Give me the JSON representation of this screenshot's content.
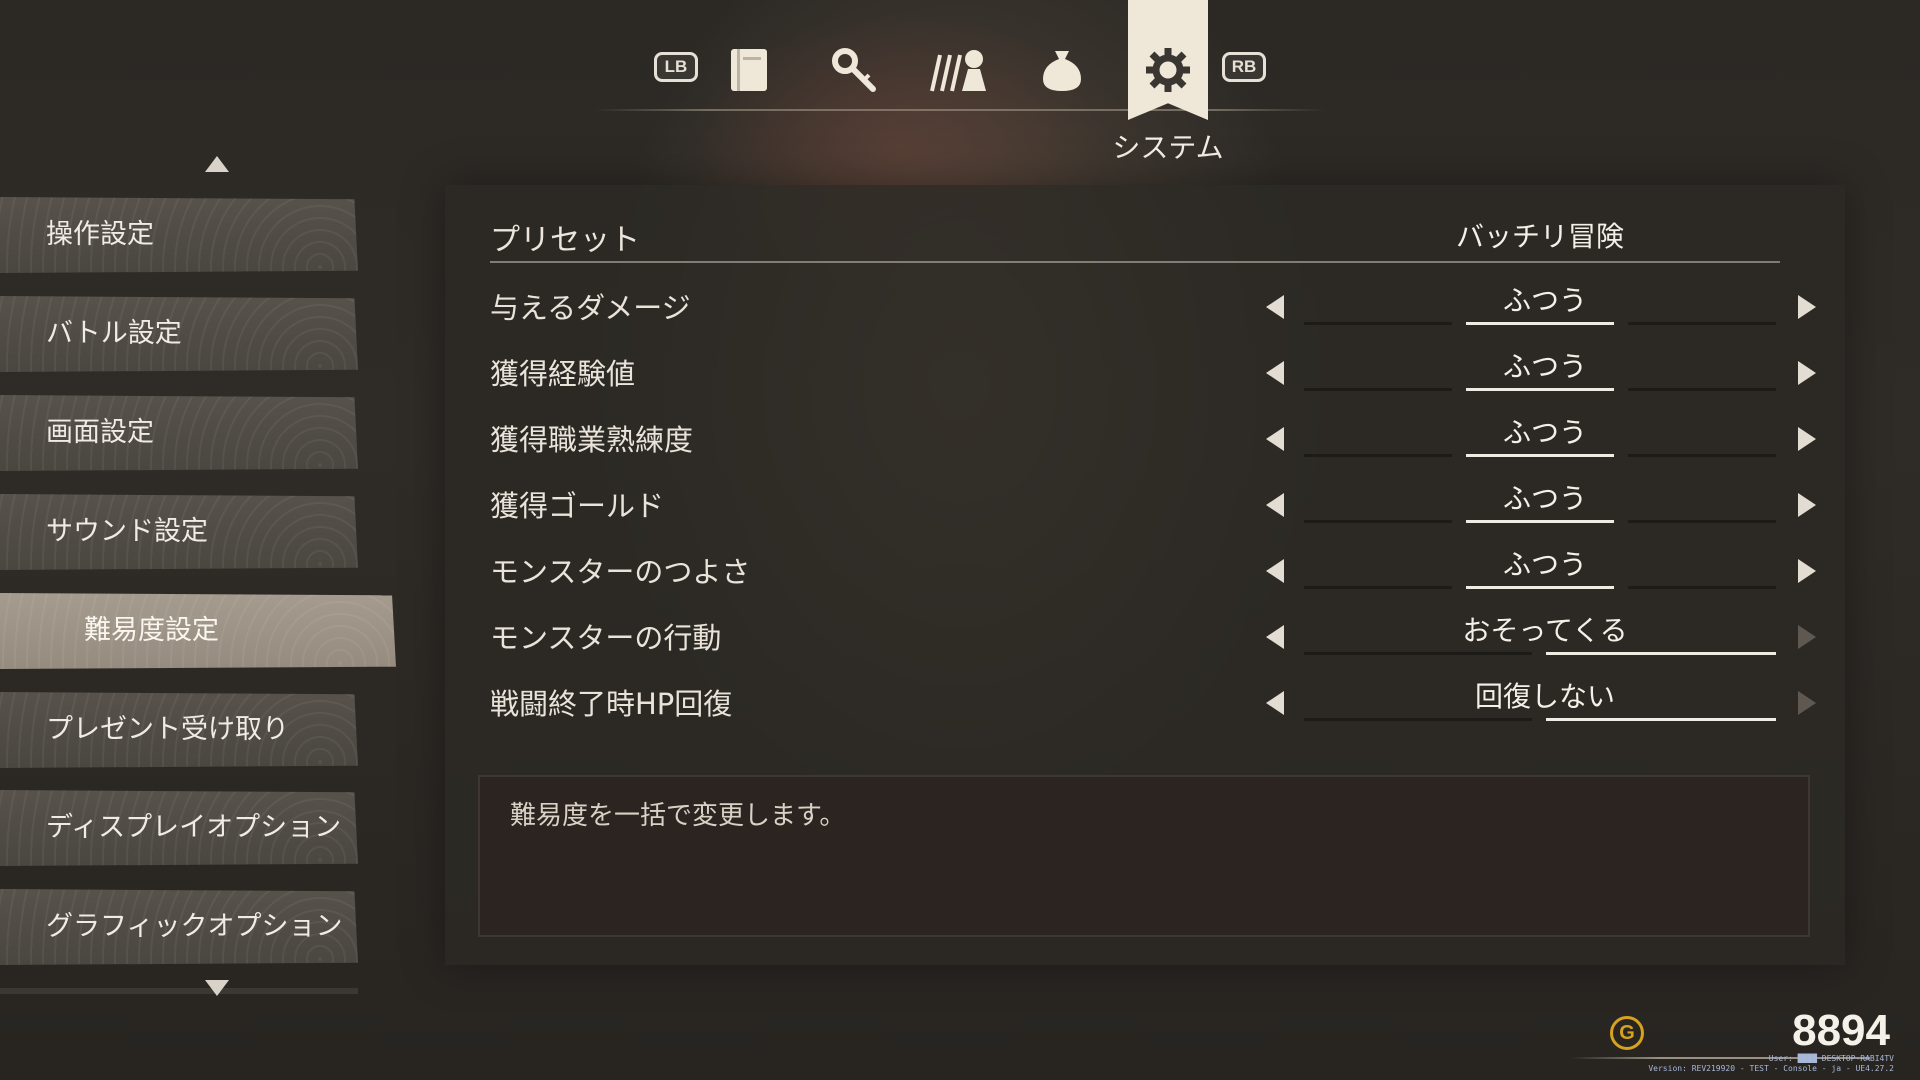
{
  "tabs": {
    "lb_label": "LB",
    "rb_label": "RB",
    "icons": [
      "book-icon",
      "magnifier-key-icon",
      "party-icon",
      "item-bag-icon",
      "gear-icon"
    ],
    "active_label": "システム"
  },
  "sidebar": {
    "items": [
      {
        "label": "操作設定",
        "active": false
      },
      {
        "label": "バトル設定",
        "active": false
      },
      {
        "label": "画面設定",
        "active": false
      },
      {
        "label": "サウンド設定",
        "active": false
      },
      {
        "label": "難易度設定",
        "active": true
      },
      {
        "label": "プレゼント受け取り",
        "active": false
      },
      {
        "label": "ディスプレイオプション",
        "active": false
      },
      {
        "label": "グラフィックオプション",
        "active": false
      }
    ]
  },
  "panel": {
    "preset": {
      "label": "プリセット",
      "value": "バッチリ冒険"
    },
    "settings": [
      {
        "name": "与えるダメージ",
        "value": "ふつう",
        "options": 3,
        "selected": 2
      },
      {
        "name": "獲得経験値",
        "value": "ふつう",
        "options": 3,
        "selected": 2
      },
      {
        "name": "獲得職業熟練度",
        "value": "ふつう",
        "options": 3,
        "selected": 2
      },
      {
        "name": "獲得ゴールド",
        "value": "ふつう",
        "options": 3,
        "selected": 2
      },
      {
        "name": "モンスターのつよさ",
        "value": "ふつう",
        "options": 3,
        "selected": 2
      },
      {
        "name": "モンスターの行動",
        "value": "おそってくる",
        "options": 2,
        "selected": 2
      },
      {
        "name": "戦闘終了時HP回復",
        "value": "回復しない",
        "options": 2,
        "selected": 2
      }
    ],
    "description": "難易度を一括で変更します。"
  },
  "gold": {
    "amount": "8894",
    "icon_letter": "G"
  },
  "build_info": {
    "line1": "User: ████ DESKTOP-RABI4TV",
    "line2": "Version: REV219920 - TEST - Console - ja - UE4.27.2"
  },
  "colors": {
    "gold": "#d6a21f",
    "active_tab": "#efe7d8",
    "active_sidebar": "#a59b8e"
  }
}
